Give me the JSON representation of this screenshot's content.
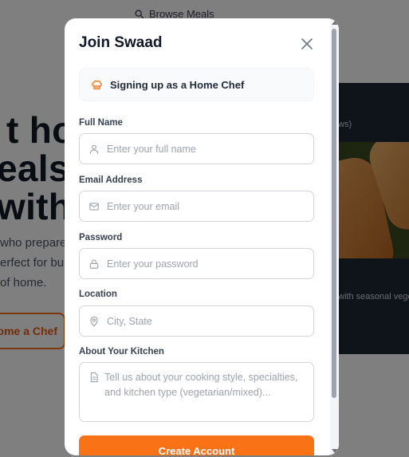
{
  "background": {
    "nav_browse": "Browse Meals",
    "hero_lines": [
      "t home",
      "eals",
      "with"
    ],
    "copy_lines": [
      "who prepare",
      "erfect for bu",
      "of home."
    ],
    "become_chef": "come a Chef",
    "card_subtitle": "ws)",
    "card_desc": "with seasonal vege"
  },
  "modal": {
    "title": "Join Swaad",
    "role_banner": "Signing up as a Home Chef",
    "fields": {
      "full_name": {
        "label": "Full Name",
        "placeholder": "Enter your full name",
        "icon": "user-icon"
      },
      "email": {
        "label": "Email Address",
        "placeholder": "Enter your email",
        "icon": "mail-icon"
      },
      "password": {
        "label": "Password",
        "placeholder": "Enter your password",
        "icon": "lock-icon"
      },
      "location": {
        "label": "Location",
        "placeholder": "City, State",
        "icon": "map-pin-icon"
      },
      "kitchen": {
        "label": "About Your Kitchen",
        "placeholder": "Tell us about your cooking style, specialties, and kitchen type (vegetarian/mixed)...",
        "icon": "document-icon"
      }
    },
    "submit_label": "Create Account"
  },
  "colors": {
    "accent": "#f97316",
    "overlay": "rgba(0,0,0,0.5)",
    "card_bg": "#1f2937"
  }
}
